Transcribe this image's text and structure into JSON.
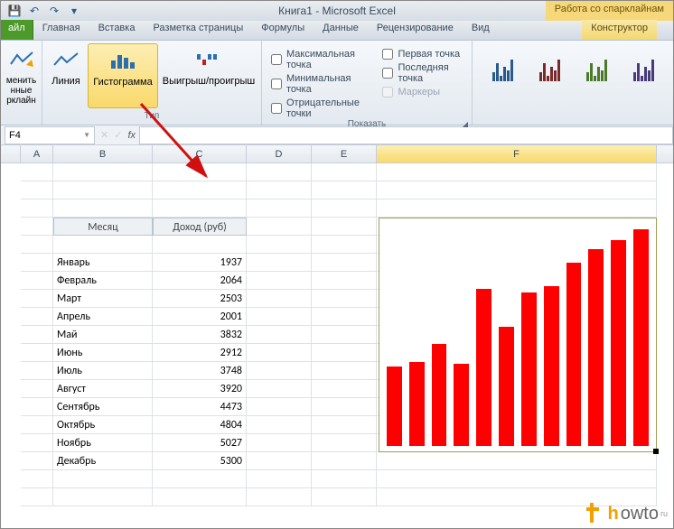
{
  "titlebar": {
    "title": "Книга1 - Microsoft Excel",
    "contextual": "Работа со спарклайнам"
  },
  "tabs": {
    "file": "айл",
    "items": [
      "Главная",
      "Вставка",
      "Разметка страницы",
      "Формулы",
      "Данные",
      "Рецензирование",
      "Вид"
    ],
    "contextual": "Конструктор"
  },
  "ribbon": {
    "group_sparkline_btn": "менить\nнные\nрклайн",
    "type": {
      "line": "Линия",
      "histogram": "Гистограмма",
      "winloss": "Выигрыш/проигрыш",
      "group": "Тип"
    },
    "show": {
      "max_point": "Максимальная точка",
      "first_point": "Первая точка",
      "min_point": "Минимальная точка",
      "last_point": "Последняя точка",
      "neg_point": "Отрицательные точки",
      "markers": "Маркеры",
      "group": "Показать"
    }
  },
  "namebox": "F4",
  "columns": [
    "A",
    "B",
    "C",
    "D",
    "E",
    "F"
  ],
  "table": {
    "headers": {
      "month": "Месяц",
      "income": "Доход (руб)"
    },
    "rows": [
      {
        "month": "Январь",
        "income": 1937
      },
      {
        "month": "Февраль",
        "income": 2064
      },
      {
        "month": "Март",
        "income": 2503
      },
      {
        "month": "Апрель",
        "income": 2001
      },
      {
        "month": "Май",
        "income": 3832
      },
      {
        "month": "Июнь",
        "income": 2912
      },
      {
        "month": "Июль",
        "income": 3748
      },
      {
        "month": "Август",
        "income": 3920
      },
      {
        "month": "Сентябрь",
        "income": 4473
      },
      {
        "month": "Октябрь",
        "income": 4804
      },
      {
        "month": "Ноябрь",
        "income": 5027
      },
      {
        "month": "Декабрь",
        "income": 5300
      }
    ]
  },
  "chart_data": {
    "type": "bar",
    "categories": [
      "Январь",
      "Февраль",
      "Март",
      "Апрель",
      "Май",
      "Июнь",
      "Июль",
      "Август",
      "Сентябрь",
      "Октябрь",
      "Ноябрь",
      "Декабрь"
    ],
    "values": [
      1937,
      2064,
      2503,
      2001,
      3832,
      2912,
      3748,
      3920,
      4473,
      4804,
      5027,
      5300
    ],
    "title": "",
    "xlabel": "",
    "ylabel": "",
    "ylim": [
      0,
      5300
    ]
  },
  "watermark": {
    "brand": "howto",
    "suffix": "ru"
  }
}
